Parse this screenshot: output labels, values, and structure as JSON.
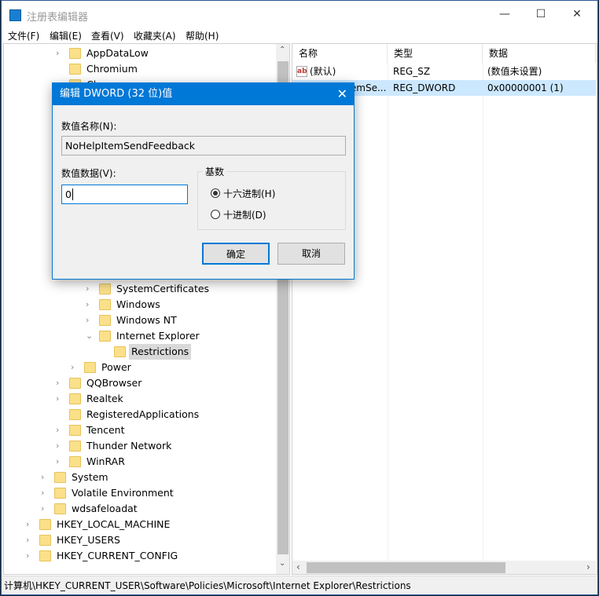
{
  "window": {
    "title": "注册表编辑器",
    "minimize": "—",
    "maximize": "☐",
    "close": "✕"
  },
  "menu": [
    "文件(F)",
    "编辑(E)",
    "查看(V)",
    "收藏夹(A)",
    "帮助(H)"
  ],
  "tree": [
    {
      "label": "AppDataLow",
      "level": 3,
      "arrow": "collapsed"
    },
    {
      "label": "Chromium",
      "level": 3,
      "arrow": "none"
    },
    {
      "label": "Classes",
      "level": 3,
      "arrow": "collapsed"
    },
    {
      "label": "SystemCertificates",
      "level": 5,
      "arrow": "collapsed",
      "gap": true
    },
    {
      "label": "Windows",
      "level": 5,
      "arrow": "collapsed"
    },
    {
      "label": "Windows NT",
      "level": 5,
      "arrow": "collapsed"
    },
    {
      "label": "Internet Explorer",
      "level": 5,
      "arrow": "expanded"
    },
    {
      "label": "Restrictions",
      "level": 6,
      "arrow": "none",
      "selected": true
    },
    {
      "label": "Power",
      "level": 4,
      "arrow": "collapsed"
    },
    {
      "label": "QQBrowser",
      "level": 3,
      "arrow": "collapsed"
    },
    {
      "label": "Realtek",
      "level": 3,
      "arrow": "collapsed"
    },
    {
      "label": "RegisteredApplications",
      "level": 3,
      "arrow": "none"
    },
    {
      "label": "Tencent",
      "level": 3,
      "arrow": "collapsed"
    },
    {
      "label": "Thunder Network",
      "level": 3,
      "arrow": "collapsed"
    },
    {
      "label": "WinRAR",
      "level": 3,
      "arrow": "collapsed"
    },
    {
      "label": "System",
      "level": 2,
      "arrow": "collapsed"
    },
    {
      "label": "Volatile Environment",
      "level": 2,
      "arrow": "collapsed"
    },
    {
      "label": "wdsafeloadat",
      "level": 2,
      "arrow": "collapsed"
    },
    {
      "label": "HKEY_LOCAL_MACHINE",
      "level": 1,
      "arrow": "collapsed"
    },
    {
      "label": "HKEY_USERS",
      "level": 1,
      "arrow": "collapsed"
    },
    {
      "label": "HKEY_CURRENT_CONFIG",
      "level": 1,
      "arrow": "collapsed"
    }
  ],
  "list": {
    "headers": [
      "名称",
      "类型",
      "数据"
    ],
    "rows": [
      {
        "name": "(默认)",
        "type": "REG_SZ",
        "data": "(数值未设置)",
        "icon": "string-value-icon"
      },
      {
        "name": "NoHelpItemSe...",
        "type": "REG_DWORD",
        "data": "0x00000001 (1)",
        "icon": "dword-value-icon",
        "selected": true
      }
    ]
  },
  "status": "计算机\\HKEY_CURRENT_USER\\Software\\Policies\\Microsoft\\Internet Explorer\\Restrictions",
  "dialog": {
    "title": "编辑 DWORD (32 位)值",
    "close": "✕",
    "name_label": "数值名称(N):",
    "name_value": "NoHelpItemSendFeedback",
    "data_label": "数值数据(V):",
    "data_value": "0",
    "base_label": "基数",
    "radio_hex": "十六进制(H)",
    "radio_dec": "十进制(D)",
    "selected_base": "hex",
    "ok": "确定",
    "cancel": "取消"
  },
  "colors": {
    "accent": "#0078d7",
    "selection": "#cce8ff"
  }
}
